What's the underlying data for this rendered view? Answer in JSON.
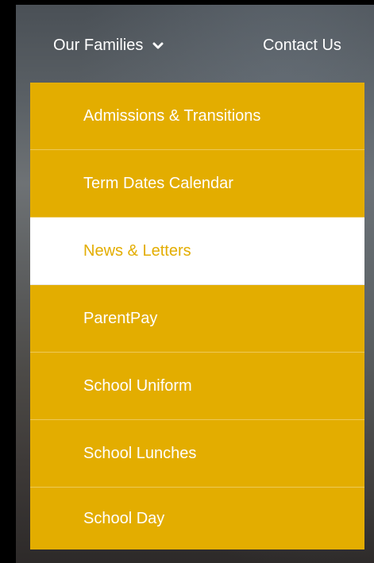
{
  "nav": {
    "items": [
      {
        "label": "Our Families",
        "icon": "chevron-down-icon"
      },
      {
        "label": "Contact Us"
      }
    ]
  },
  "dropdown": {
    "items": [
      {
        "label": "Admissions & Transitions",
        "active": false
      },
      {
        "label": "Term Dates Calendar",
        "active": false
      },
      {
        "label": "News & Letters",
        "active": true
      },
      {
        "label": "ParentPay",
        "active": false
      },
      {
        "label": "School Uniform",
        "active": false
      },
      {
        "label": "School Lunches",
        "active": false
      },
      {
        "label": "School Day",
        "active": false
      }
    ]
  },
  "colors": {
    "accent": "#e3ad00",
    "active_bg": "#ffffff",
    "text": "#ffffff",
    "page_bg": "#000000"
  }
}
